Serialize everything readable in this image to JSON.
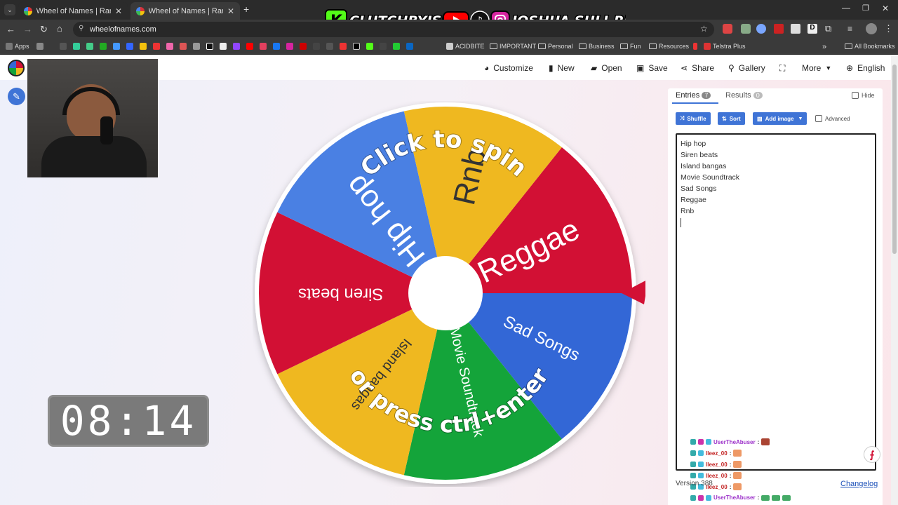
{
  "browser": {
    "tabs": [
      {
        "title": "Wheel of Names | Random nam",
        "active": false
      },
      {
        "title": "Wheel of Names | Random nam",
        "active": true
      }
    ],
    "url": "wheelofnames.com",
    "bookmarks": {
      "apps": "Apps",
      "items": [
        "ACIDBITE",
        "IMPORTANT",
        "Personal",
        "Business",
        "Fun",
        "Resources",
        "Telstra Plus"
      ],
      "all": "All Bookmarks"
    }
  },
  "overlay": {
    "brand_left": "CLUTCHBYJSR",
    "brand_right": "JOSHUA SULI-RUKA",
    "timer": "08:14"
  },
  "nav": {
    "customize": "Customize",
    "new": "New",
    "open": "Open",
    "save": "Save",
    "share": "Share",
    "gallery": "Gallery",
    "more": "More",
    "language": "English"
  },
  "wheel": {
    "slices": [
      {
        "label": "Reggae",
        "color": "#d21034"
      },
      {
        "label": "Sad Songs",
        "color": "#3367d6"
      },
      {
        "label": "Movie Soundtrack",
        "color": "#14a43a"
      },
      {
        "label": "Island bangas",
        "color": "#efb820"
      },
      {
        "label": "Siren beats",
        "color": "#d21034"
      },
      {
        "label": "Hip hop",
        "color": "#4a80e3"
      },
      {
        "label": "Rnb",
        "color": "#efb820"
      }
    ],
    "prompt_top": "Click to spin",
    "prompt_bottom": "or press ctrl+enter"
  },
  "panel": {
    "tabs": [
      {
        "label": "Entries",
        "count": "7"
      },
      {
        "label": "Results",
        "count": "0"
      }
    ],
    "hide": "Hide",
    "buttons": {
      "shuffle": "Shuffle",
      "sort": "Sort",
      "add_image": "Add image"
    },
    "advanced": "Advanced",
    "entries": [
      "Hip hop",
      "Siren beats",
      "Island bangas",
      "Movie Soundtrack",
      "Sad Songs",
      "Reggae",
      "Rnb"
    ],
    "version": "Version 388",
    "changelog": "Changelog"
  },
  "chat": [
    {
      "user": "UserTheAbuser",
      "color": "#9b2fc9"
    },
    {
      "user": "lleez_00",
      "color": "#c21f1f"
    },
    {
      "user": "lleez_00",
      "color": "#c21f1f"
    },
    {
      "user": "lleez_00",
      "color": "#c21f1f"
    },
    {
      "user": "lleez_00",
      "color": "#c21f1f"
    },
    {
      "user": "UserTheAbuser",
      "color": "#9b2fc9"
    }
  ],
  "colors": {
    "accent": "#3f74d6",
    "pointer": "#d21034"
  }
}
